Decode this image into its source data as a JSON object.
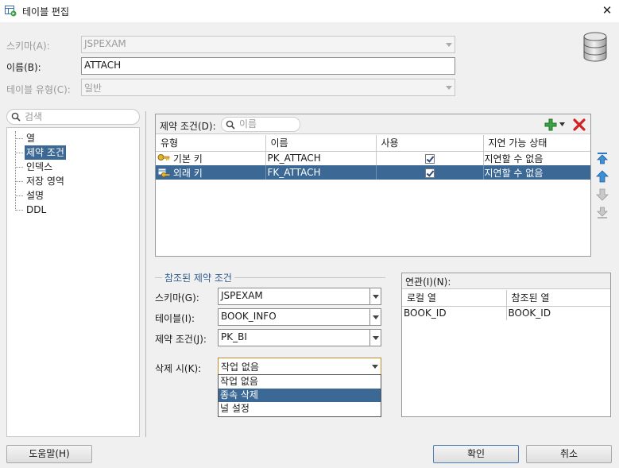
{
  "window": {
    "title": "테이블 편집",
    "close_glyph": "✕",
    "app_icon": "table-edit-icon"
  },
  "form": {
    "schema_label": "스키마(A):",
    "schema_value": "JSPEXAM",
    "name_label": "이름(B):",
    "name_value": "ATTACH",
    "table_type_label": "테이블 유형(C):",
    "table_type_value": "일반",
    "db_icon": "database-icon"
  },
  "nav": {
    "search_placeholder": "검색",
    "items": [
      {
        "label": "열"
      },
      {
        "label": "제약 조건"
      },
      {
        "label": "인덱스"
      },
      {
        "label": "저장 영역"
      },
      {
        "label": "설명"
      },
      {
        "label": "DDL"
      }
    ],
    "selected": "제약 조건"
  },
  "constraints": {
    "label": "제약 조건(D):",
    "filter_placeholder": "이름",
    "add_icon": "add-icon",
    "delete_icon": "delete-icon",
    "columns": [
      "유형",
      "이름",
      "사용",
      "지연 가능 상태"
    ],
    "rows": [
      {
        "type": "기본 키",
        "name": "PK_ATTACH",
        "enabled": true,
        "deferrable": "지연할 수 없음",
        "icon": "primary-key-icon"
      },
      {
        "type": "외래 키",
        "name": "FK_ATTACH",
        "enabled": true,
        "deferrable": "지연할 수 없음",
        "icon": "foreign-key-icon"
      }
    ],
    "selected_row": 1,
    "side_buttons": [
      "move-top-icon",
      "move-up-icon",
      "move-down-icon",
      "move-bottom-icon"
    ]
  },
  "referenced": {
    "group_title": "참조된 제약 조건",
    "schema_label": "스키마(G):",
    "schema_value": "JSPEXAM",
    "table_label": "테이블(I):",
    "table_value": "BOOK_INFO",
    "constraint_label": "제약 조건(J):",
    "constraint_value": "PK_BI",
    "on_delete_label": "삭제 시(K):",
    "on_delete_value": "작업 없음",
    "on_delete_options": [
      "작업 없음",
      "종속 삭제",
      "널 설정"
    ],
    "highlighted_option": "종속 삭제"
  },
  "association": {
    "label": "연관(I)(N):",
    "columns": [
      "로컬 열",
      "참조된 열"
    ],
    "rows": [
      {
        "local": "BOOK_ID",
        "referenced": "BOOK_ID"
      }
    ]
  },
  "buttons": {
    "help": "도움말(H)",
    "ok": "확인",
    "cancel": "취소"
  }
}
